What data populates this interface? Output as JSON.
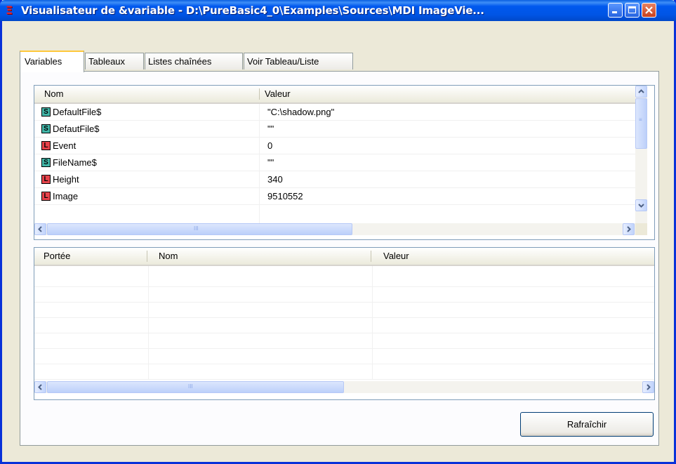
{
  "window": {
    "title": "Visualisateur de &variable - D:\\PureBasic4_0\\Examples\\Sources\\MDI ImageVie...",
    "icon": "purebasic-icon"
  },
  "tabs": [
    {
      "label": "Variables",
      "active": true
    },
    {
      "label": "Tableaux",
      "active": false
    },
    {
      "label": "Listes chaînées",
      "active": false
    },
    {
      "label": "Voir Tableau/Liste",
      "active": false
    }
  ],
  "variables_list": {
    "columns": [
      "Nom",
      "Valeur"
    ],
    "rows": [
      {
        "type": "S",
        "name": "DefaultFile$",
        "value": "\"C:\\shadow.png\""
      },
      {
        "type": "S",
        "name": "DefautFile$",
        "value": "\"\""
      },
      {
        "type": "L",
        "name": "Event",
        "value": "0"
      },
      {
        "type": "S",
        "name": "FileName$",
        "value": "\"\""
      },
      {
        "type": "L",
        "name": "Height",
        "value": "340"
      },
      {
        "type": "L",
        "name": "Image",
        "value": "9510552"
      }
    ]
  },
  "scope_list": {
    "columns": [
      "Portée",
      "Nom",
      "Valeur"
    ],
    "rows": []
  },
  "buttons": {
    "refresh_label": "Rafraîchir"
  },
  "colors": {
    "titlebar": "#0055E5",
    "window_bg": "#ECE9D8",
    "string_badge": "#41B6A8",
    "long_badge": "#E8434B"
  }
}
